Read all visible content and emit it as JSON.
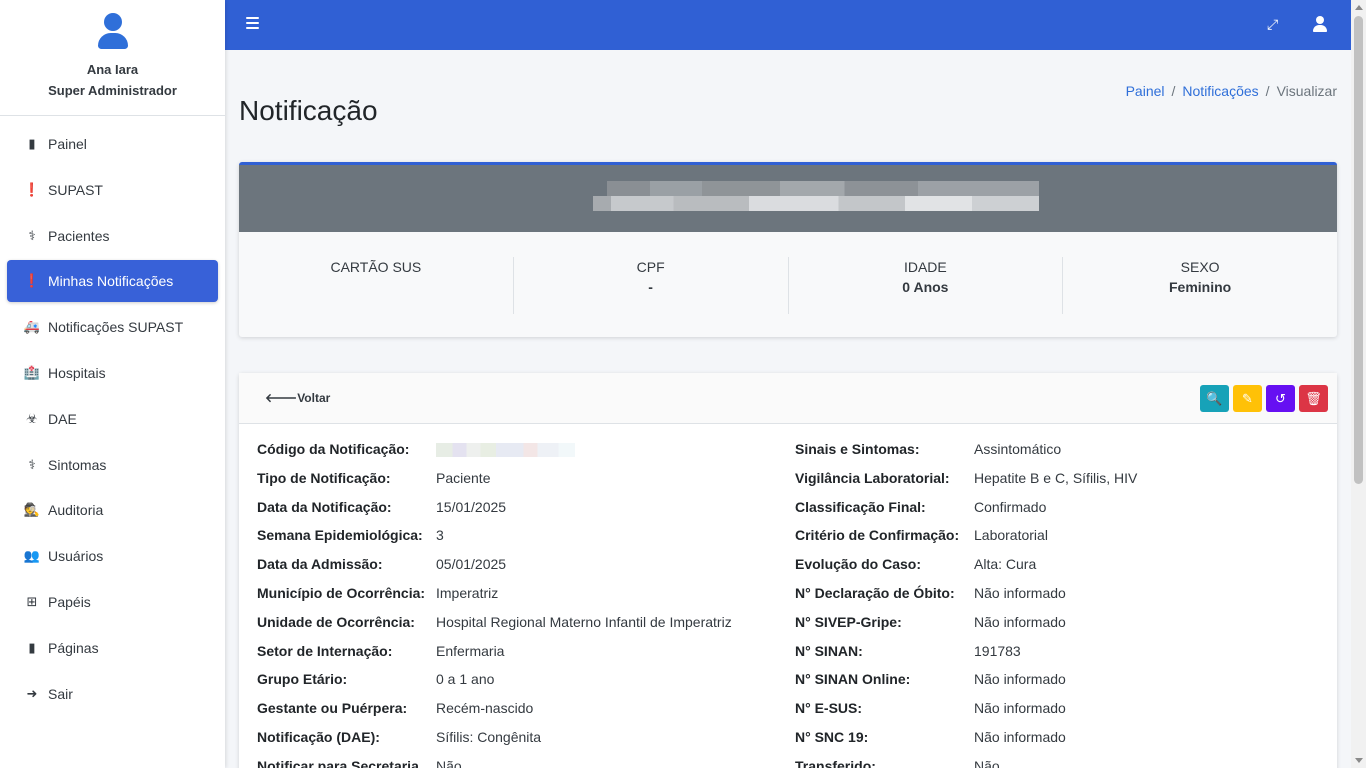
{
  "user": {
    "name": "Ana Iara",
    "role": "Super Administrador"
  },
  "nav": [
    {
      "label": "Painel",
      "icon": "clipboard-icon",
      "glyph": "▮"
    },
    {
      "label": "SUPAST",
      "icon": "alert-circle-icon",
      "glyph": "❗"
    },
    {
      "label": "Pacientes",
      "icon": "user-injured-icon",
      "glyph": "⚕"
    },
    {
      "label": "Minhas Notificações",
      "icon": "alert-circle-icon",
      "glyph": "❗"
    },
    {
      "label": "Notificações SUPAST",
      "icon": "ambulance-icon",
      "glyph": "🚑"
    },
    {
      "label": "Hospitais",
      "icon": "hospital-icon",
      "glyph": "🏥"
    },
    {
      "label": "DAE",
      "icon": "head-virus-icon",
      "glyph": "☣"
    },
    {
      "label": "Sintomas",
      "icon": "stethoscope-icon",
      "glyph": "⚕"
    },
    {
      "label": "Auditoria",
      "icon": "user-secret-icon",
      "glyph": "🕵"
    },
    {
      "label": "Usuários",
      "icon": "users-icon",
      "glyph": "👥"
    },
    {
      "label": "Papéis",
      "icon": "sitemap-icon",
      "glyph": "⊞"
    },
    {
      "label": "Páginas",
      "icon": "file-icon",
      "glyph": "▮"
    },
    {
      "label": "Sair",
      "icon": "sign-out-icon",
      "glyph": "➜"
    }
  ],
  "active_nav": "Minhas Notificações",
  "page": {
    "title": "Notificação"
  },
  "breadcrumb": {
    "item1": "Painel",
    "item2": "Notificações",
    "item3": "Visualizar"
  },
  "profile": {
    "cartao_sus_label": "CARTÃO SUS",
    "cpf_label": "CPF",
    "cpf_value": "-",
    "idade_label": "IDADE",
    "idade_value": "0 Anos",
    "sexo_label": "SEXO",
    "sexo_value": "Feminino"
  },
  "detail": {
    "back_label": "Voltar",
    "left": [
      {
        "k": "Código da Notificação:",
        "v": ""
      },
      {
        "k": "Tipo de Notificação:",
        "v": "Paciente"
      },
      {
        "k": "Data da Notificação:",
        "v": "15/01/2025"
      },
      {
        "k": "Semana Epidemiológica:",
        "v": "3"
      },
      {
        "k": "Data da Admissão:",
        "v": "05/01/2025"
      },
      {
        "k": "Município de Ocorrência:",
        "v": "Imperatriz"
      },
      {
        "k": "Unidade de Ocorrência:",
        "v": "Hospital Regional Materno Infantil de Imperatriz"
      },
      {
        "k": "Setor de Internação:",
        "v": "Enfermaria"
      },
      {
        "k": "Grupo Etário:",
        "v": "0 a 1 ano"
      },
      {
        "k": "Gestante ou Puérpera:",
        "v": "Recém-nascido"
      },
      {
        "k": "Notificação (DAE):",
        "v": "Sífilis: Congênita"
      },
      {
        "k": "Notificar para Secretaria",
        "v": "Não"
      }
    ],
    "right": [
      {
        "k": "Sinais e Sintomas:",
        "v": "Assintomático"
      },
      {
        "k": "Vigilância Laboratorial:",
        "v": "Hepatite B e C, Sífilis, HIV"
      },
      {
        "k": "Classificação Final:",
        "v": "Confirmado"
      },
      {
        "k": "Critério de Confirmação:",
        "v": "Laboratorial"
      },
      {
        "k": "Evolução do Caso:",
        "v": "Alta: Cura"
      },
      {
        "k": "N° Declaração de Óbito:",
        "v": "Não informado"
      },
      {
        "k": "N° SIVEP-Gripe:",
        "v": "Não informado"
      },
      {
        "k": "N° SINAN:",
        "v": "191783"
      },
      {
        "k": "N° SINAN Online:",
        "v": "Não informado"
      },
      {
        "k": "N° E-SUS:",
        "v": "Não informado"
      },
      {
        "k": "N° SNC 19:",
        "v": "Não informado"
      },
      {
        "k": "Transferido:",
        "v": "Não"
      }
    ]
  },
  "colors": {
    "primary": "#3060d4",
    "header_gray": "#6c757d",
    "info": "#17a2b8",
    "warning": "#ffc107",
    "purple": "#6610f2",
    "danger": "#dc3545"
  }
}
